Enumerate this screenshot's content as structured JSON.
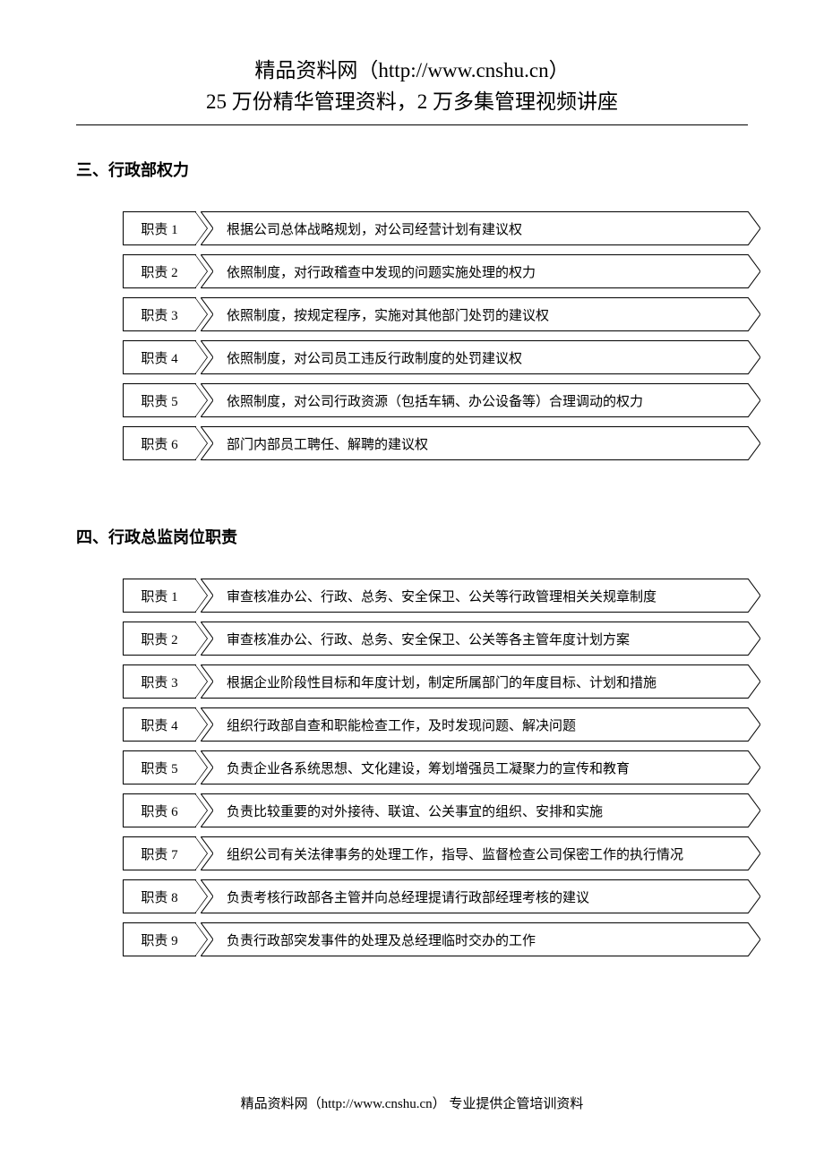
{
  "header": {
    "line1": "精品资料网（http://www.cnshu.cn）",
    "line2": "25 万份精华管理资料，2 万多集管理视频讲座"
  },
  "section3": {
    "heading": "三、行政部权力",
    "rows": [
      {
        "tag": "职责 1",
        "desc": "根据公司总体战略规划，对公司经营计划有建议权"
      },
      {
        "tag": "职责 2",
        "desc": "依照制度，对行政稽查中发现的问题实施处理的权力"
      },
      {
        "tag": "职责 3",
        "desc": "依照制度，按规定程序，实施对其他部门处罚的建议权"
      },
      {
        "tag": "职责 4",
        "desc": "依照制度，对公司员工违反行政制度的处罚建议权"
      },
      {
        "tag": "职责 5",
        "desc": "依照制度，对公司行政资源（包括车辆、办公设备等）合理调动的权力"
      },
      {
        "tag": "职责 6",
        "desc": "部门内部员工聘任、解聘的建议权"
      }
    ]
  },
  "section4": {
    "heading": "四、行政总监岗位职责",
    "rows": [
      {
        "tag": "职责 1",
        "desc": "审查核准办公、行政、总务、安全保卫、公关等行政管理相关关规章制度"
      },
      {
        "tag": "职责 2",
        "desc": "审查核准办公、行政、总务、安全保卫、公关等各主管年度计划方案"
      },
      {
        "tag": "职责 3",
        "desc": "根据企业阶段性目标和年度计划，制定所属部门的年度目标、计划和措施"
      },
      {
        "tag": "职责 4",
        "desc": "组织行政部自查和职能检查工作，及时发现问题、解决问题"
      },
      {
        "tag": "职责 5",
        "desc": "负责企业各系统思想、文化建设，筹划增强员工凝聚力的宣传和教育"
      },
      {
        "tag": "职责 6",
        "desc": "负责比较重要的对外接待、联谊、公关事宜的组织、安排和实施"
      },
      {
        "tag": "职责 7",
        "desc": "组织公司有关法律事务的处理工作，指导、监督检查公司保密工作的执行情况"
      },
      {
        "tag": "职责 8",
        "desc": "负责考核行政部各主管并向总经理提请行政部经理考核的建议"
      },
      {
        "tag": "职责 9",
        "desc": "负责行政部突发事件的处理及总经理临时交办的工作"
      }
    ]
  },
  "footer": "精品资料网（http://www.cnshu.cn）  专业提供企管培训资料"
}
